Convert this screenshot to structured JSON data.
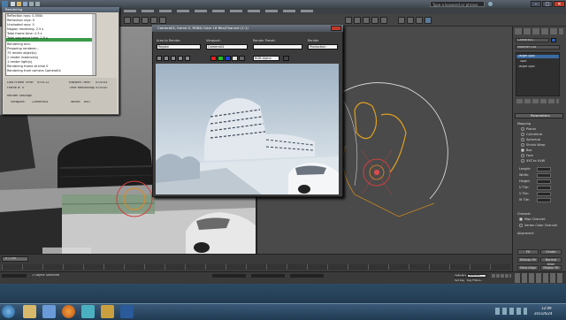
{
  "window": {
    "title": "",
    "search_placeholder": "Type a keyword or phrase",
    "min": "–",
    "max": "□",
    "close": "✕"
  },
  "progress_dialog": {
    "title": "Rendering",
    "log": [
      "Reflection rays: 0.550k",
      "Refraction rays: 0",
      "Unshaded rays: 0",
      "Nippon rendering: 2.5 s",
      "Total frame time: 2.5 s",
      "Total sequence time: 2.5 s",
      "Rendering end.",
      "Preparing renderer...",
      "75 render object(s)",
      "2 render instance(s)",
      "1 render light(s)",
      "Rendering frame at time 0",
      "Rendering from camera Camera04"
    ],
    "rows": [
      {
        "label": "Last Frame Time:",
        "value": "0:00:12"
      },
      {
        "label": "Elapsed Time:",
        "value": "0:00:04"
      },
      {
        "label": "Time Remaining:",
        "value": "0:00:00"
      },
      {
        "label": "Frame #",
        "value": "0"
      },
      {
        "label": "Viewport:",
        "value": "Camera04"
      },
      {
        "label": "Width:",
        "value": "640"
      }
    ],
    "section": "Render Settings"
  },
  "frame_buffer": {
    "title": "Camera04, frame 0, RGBA Color 16 Bits/Channel (1:1)",
    "area_label": "Area to Render:",
    "area_value": "Region",
    "viewport_label": "Viewport:",
    "viewport_value": "Camera04",
    "preset_label": "Render Preset:",
    "preset_value": "",
    "renderer_label": "Render",
    "renderer_value": "Production",
    "channel_value": "RGB Alpha"
  },
  "command_panel": {
    "title": "Parameters",
    "object_name": "Camera01",
    "modifier_list": "Modifier List",
    "stack": [
      "Target Spot",
      "Spot",
      "Target Spot"
    ],
    "section_mapping": "Mapping",
    "options": [
      "Planar",
      "Cylindrical",
      "Spherical",
      "Shrink Wrap",
      "Box",
      "Face",
      "XYZ to UVW"
    ],
    "selected_option": "Box",
    "dims": [
      {
        "label": "Length:",
        "value": "0.0"
      },
      {
        "label": "Width:",
        "value": "0.0"
      },
      {
        "label": "Height:",
        "value": "0.0"
      },
      {
        "label": "U Tile:",
        "value": "1.0"
      },
      {
        "label": "V Tile:",
        "value": "1.0"
      },
      {
        "label": "W Tile:",
        "value": "1.0"
      }
    ],
    "flip": "Flip",
    "channel_title": "Channel:",
    "map_channel": "Map Channel:",
    "vertex_color": "Vertex Color Channel",
    "alignment": "Alignment:",
    "align_buttons": [
      "Fit",
      "Center",
      "Bitmap Fit",
      "Normal Align",
      "View Align",
      "Region Fit",
      "Reset",
      "Acquire"
    ]
  },
  "status": {
    "selection": "1 Object Selected",
    "frame": "0 / 100",
    "auto_key": "Auto Key",
    "selected": "Selected",
    "set_key": "Set Key",
    "key_filters": "Key Filters..."
  },
  "taskbar": {
    "clock": "12:09",
    "date": "2011/6/24",
    "apps": [
      "start",
      "explorer",
      "media",
      "firefox",
      "3dsmax",
      "folder",
      "photoshop"
    ]
  },
  "colors": {
    "selection_green": "#3a9a4a",
    "gizmo_orange": "#e08a20",
    "gizmo_red": "#d04040",
    "taskbar_blue": "#2c4a64"
  }
}
